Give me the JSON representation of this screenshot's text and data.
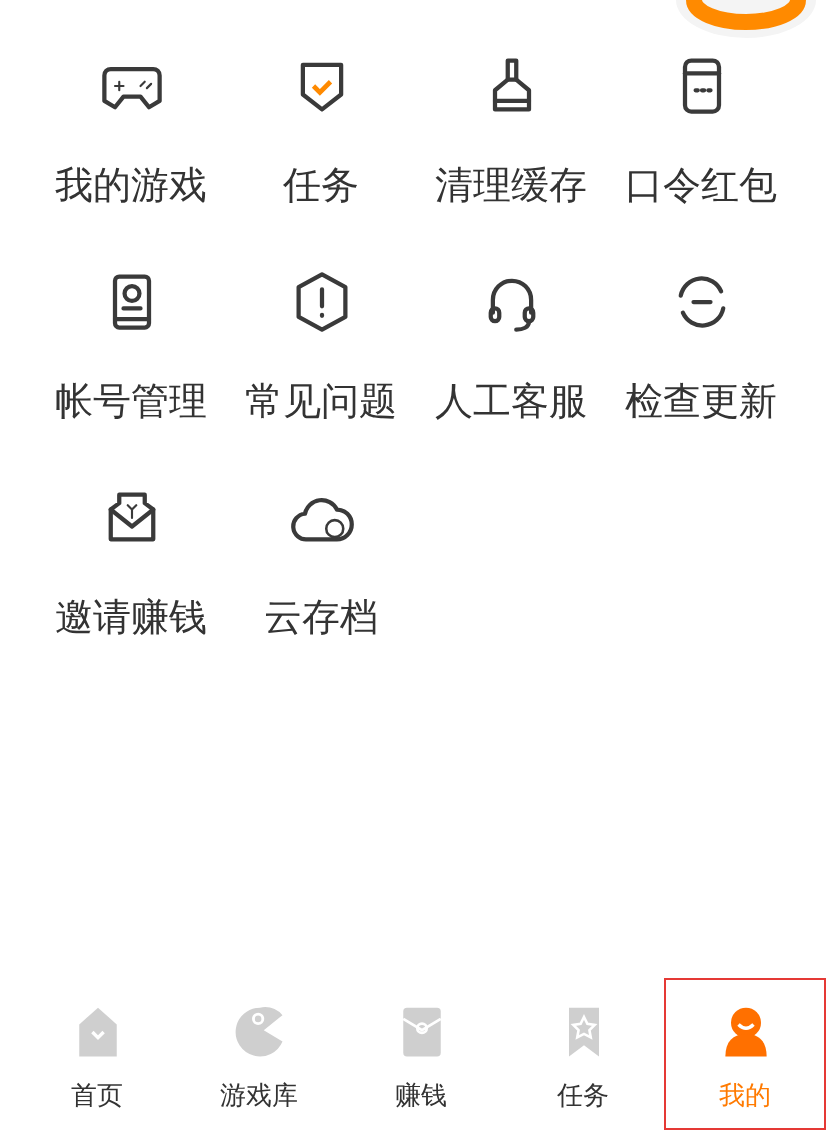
{
  "menu": [
    {
      "label": "我的游戏"
    },
    {
      "label": "任务"
    },
    {
      "label": "清理缓存"
    },
    {
      "label": "口令红包"
    },
    {
      "label": "帐号管理"
    },
    {
      "label": "常见问题"
    },
    {
      "label": "人工客服"
    },
    {
      "label": "检查更新"
    },
    {
      "label": "邀请赚钱"
    },
    {
      "label": "云存档"
    }
  ],
  "tab_bar": [
    {
      "label": "首页",
      "selected": false
    },
    {
      "label": "游戏库",
      "selected": false
    },
    {
      "label": "赚钱",
      "selected": false
    },
    {
      "label": "任务",
      "selected": false
    },
    {
      "label": "我的",
      "selected": true
    }
  ]
}
